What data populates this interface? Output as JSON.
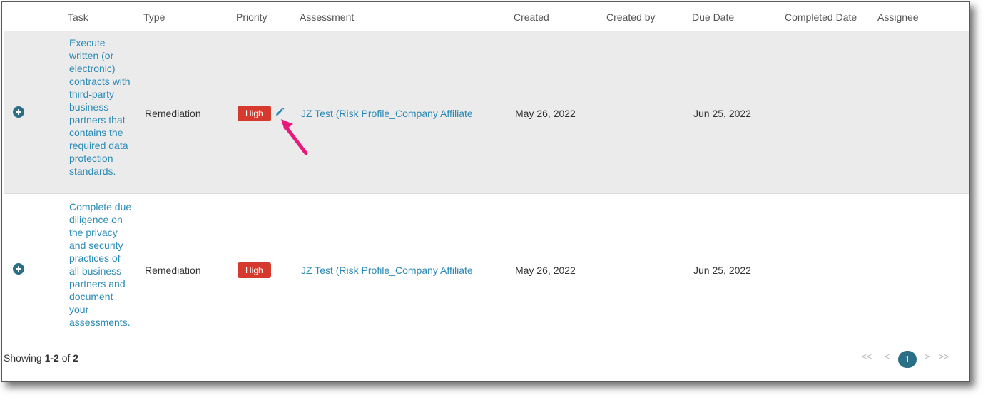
{
  "headers": {
    "task": "Task",
    "type": "Type",
    "priority": "Priority",
    "assessment": "Assessment",
    "created": "Created",
    "created_by": "Created by",
    "due_date": "Due Date",
    "completed_date": "Completed Date",
    "assignee": "Assignee"
  },
  "rows": [
    {
      "task": "Execute written (or electronic) contracts with third-party business partners that contains the required data protection standards.",
      "type": "Remediation",
      "priority": "High",
      "assessment": "JZ Test (Risk Profile_Company Affiliate",
      "created": "May 26, 2022",
      "created_by": "",
      "due_date": "Jun 25, 2022",
      "completed_date": "",
      "assignee": ""
    },
    {
      "task": "Complete due diligence on the privacy and security practices of all business partners and document your assessments.",
      "type": "Remediation",
      "priority": "High",
      "assessment": "JZ Test (Risk Profile_Company Affiliate",
      "created": "May 26, 2022",
      "created_by": "",
      "due_date": "Jun 25, 2022",
      "completed_date": "",
      "assignee": ""
    }
  ],
  "footer": {
    "showing_prefix": "Showing ",
    "range": "1-2",
    "of_text": " of ",
    "total": "2"
  },
  "pagination": {
    "first": "<<",
    "prev": "<",
    "current": "1",
    "next": ">",
    "last": ">>"
  },
  "colors": {
    "link": "#2a8ab5",
    "priority_high": "#d63a2e",
    "accent": "#2b6f86",
    "annotation_arrow": "#e8197a"
  },
  "icons": {
    "expand": "plus-circle-icon",
    "edit": "pencil-icon",
    "annotation": "arrow-annotation"
  }
}
